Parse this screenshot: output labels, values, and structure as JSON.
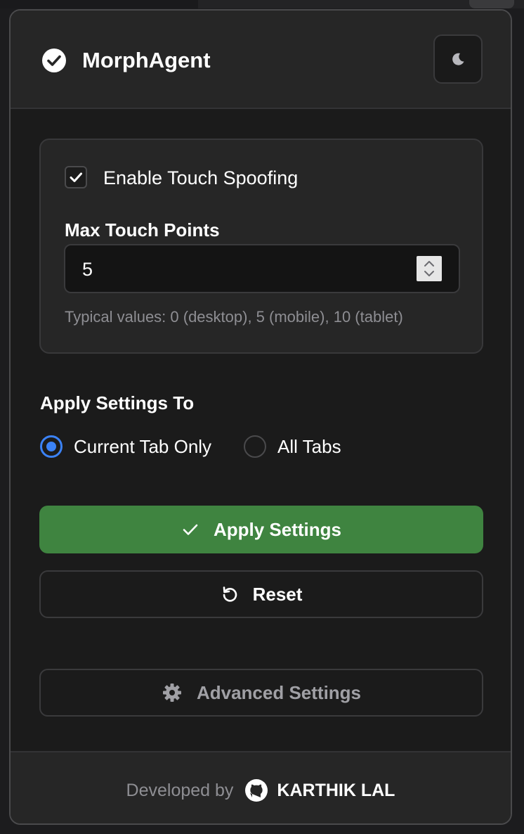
{
  "header": {
    "title": "MorphAgent",
    "logo_icon": "check-circle-icon",
    "theme_icon": "moon-icon"
  },
  "touch": {
    "enable_label": "Enable Touch Spoofing",
    "enabled": true,
    "max_points_label": "Max Touch Points",
    "max_points_value": "5",
    "hint": "Typical values: 0 (desktop), 5 (mobile), 10 (tablet)"
  },
  "apply_to": {
    "title": "Apply Settings To",
    "options": [
      {
        "label": "Current Tab Only",
        "selected": true
      },
      {
        "label": "All Tabs",
        "selected": false
      }
    ]
  },
  "buttons": {
    "apply": "Apply Settings",
    "reset": "Reset",
    "advanced": "Advanced Settings"
  },
  "footer": {
    "developed_by": "Developed by",
    "author": "KARTHIK LAL",
    "icon": "github-icon"
  },
  "colors": {
    "accent_blue": "#3b82f6",
    "apply_green": "#3f8440"
  }
}
